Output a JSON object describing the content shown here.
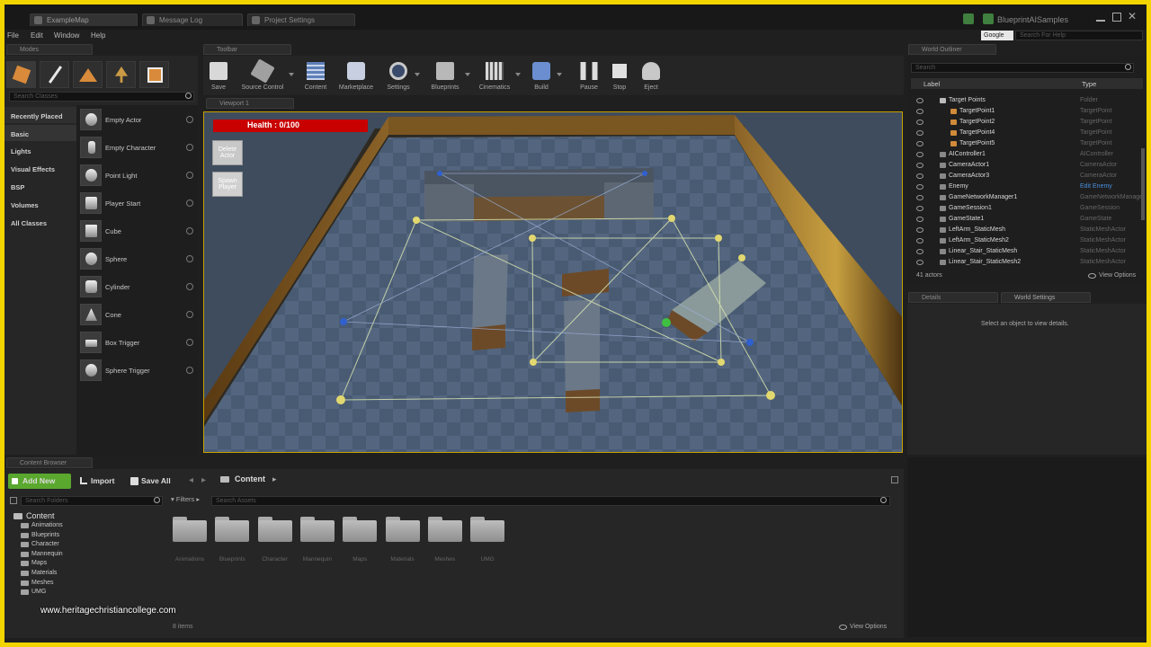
{
  "tabs": [
    {
      "label": "ExampleMap",
      "active": true
    },
    {
      "label": "Message Log",
      "active": false
    },
    {
      "label": "Project Settings",
      "active": false
    }
  ],
  "project_name": "BlueprintAISamples",
  "search_help": {
    "engine": "Google",
    "placeholder": "Search For Help"
  },
  "menu": [
    "File",
    "Edit",
    "Window",
    "Help"
  ],
  "modes": {
    "title": "Modes",
    "search_placeholder": "Search Classes",
    "categories": [
      "Recently Placed",
      "Basic",
      "Lights",
      "Visual Effects",
      "BSP",
      "Volumes",
      "All Classes"
    ],
    "items": [
      "Empty Actor",
      "Empty Character",
      "Point Light",
      "Player Start",
      "Cube",
      "Sphere",
      "Cylinder",
      "Cone",
      "Box Trigger",
      "Sphere Trigger"
    ]
  },
  "toolbar": {
    "title": "Toolbar",
    "buttons": [
      "Save",
      "Source Control",
      "Content",
      "Marketplace",
      "Settings",
      "Blueprints",
      "Cinematics",
      "Build",
      "Pause",
      "Stop",
      "Eject"
    ]
  },
  "viewport": {
    "title": "Viewport 1",
    "health_text": "Health : 0/100",
    "health_value": 0,
    "btn_top": "Delete Actor",
    "btn_bottom": "Spawn Player"
  },
  "outliner": {
    "title": "World Outliner",
    "search_placeholder": "Search",
    "col_label": "Label",
    "col_type": "Type",
    "rows": [
      {
        "label": "Target Points",
        "type": "Folder"
      },
      {
        "label": "TargetPoint1",
        "type": "TargetPoint"
      },
      {
        "label": "TargetPoint2",
        "type": "TargetPoint"
      },
      {
        "label": "TargetPoint4",
        "type": "TargetPoint"
      },
      {
        "label": "TargetPoint5",
        "type": "TargetPoint"
      },
      {
        "label": "AIController1",
        "type": "AIController"
      },
      {
        "label": "CameraActor1",
        "type": "CameraActor"
      },
      {
        "label": "CameraActor3",
        "type": "CameraActor"
      },
      {
        "label": "Enemy",
        "type": "Edit Enemy"
      },
      {
        "label": "GameNetworkManager1",
        "type": "GameNetworkManage"
      },
      {
        "label": "GameSession1",
        "type": "GameSession"
      },
      {
        "label": "GameState1",
        "type": "GameState"
      },
      {
        "label": "LeftArm_StaticMesh",
        "type": "StaticMeshActor"
      },
      {
        "label": "LeftArm_StaticMesh2",
        "type": "StaticMeshActor"
      },
      {
        "label": "Linear_Stair_StaticMesh",
        "type": "StaticMeshActor"
      },
      {
        "label": "Linear_Stair_StaticMesh2",
        "type": "StaticMeshActor"
      }
    ],
    "count": "41 actors",
    "view_options": "View Options"
  },
  "details": {
    "tab_details": "Details",
    "tab_world": "World Settings",
    "empty_msg": "Select an object to view details."
  },
  "content_browser": {
    "title": "Content Browser",
    "add_new": "Add New",
    "import": "Import",
    "save_all": "Save All",
    "path": "Content",
    "search_folders": "Search Folders",
    "filters": "Filters",
    "search_assets": "Search Assets",
    "tree_root": "Content",
    "tree": [
      "Animations",
      "Blueprints",
      "Character",
      "Mannequin",
      "Maps",
      "Materials",
      "Meshes",
      "UMG"
    ],
    "assets": [
      "Animations",
      "Blueprints",
      "Character",
      "Mannequin",
      "Maps",
      "Materials",
      "Meshes",
      "UMG"
    ],
    "item_count": "8 items",
    "view_options": "View Options"
  },
  "watermark": "www.heritagechristiancollege.com",
  "colors": {
    "accent": "#f2d400",
    "add_new": "#5aa82e",
    "health": "#c80000",
    "selection": "#c8a000"
  }
}
